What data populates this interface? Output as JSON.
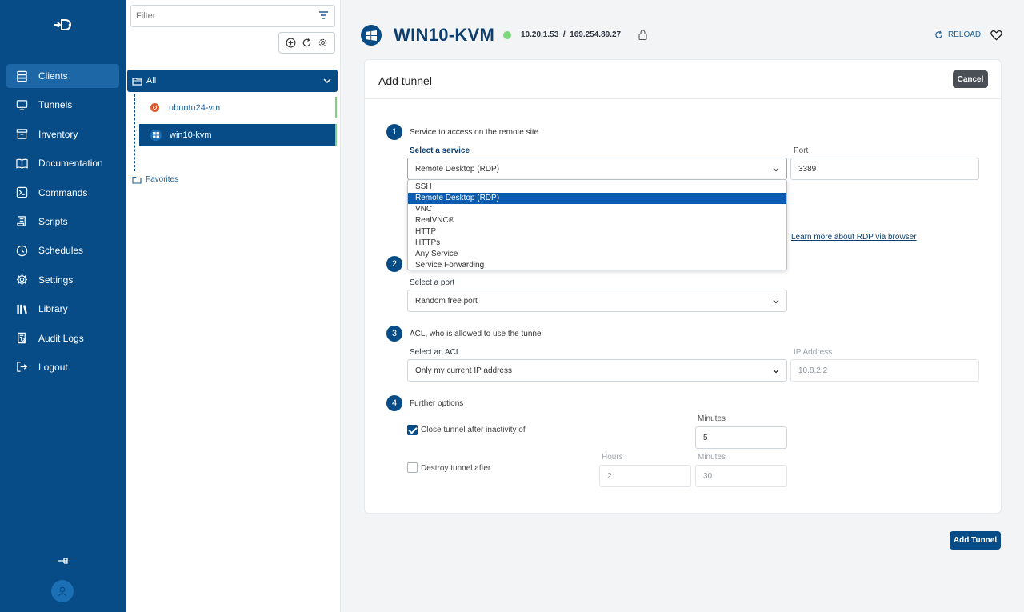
{
  "sidebar": {
    "items": [
      {
        "label": "Clients",
        "icon": "server-icon",
        "active": true
      },
      {
        "label": "Tunnels",
        "icon": "monitor-icon"
      },
      {
        "label": "Inventory",
        "icon": "archive-icon"
      },
      {
        "label": "Documentation",
        "icon": "book-icon"
      },
      {
        "label": "Commands",
        "icon": "terminal-icon"
      },
      {
        "label": "Scripts",
        "icon": "script-icon"
      },
      {
        "label": "Schedules",
        "icon": "clock-icon"
      },
      {
        "label": "Settings",
        "icon": "gear-icon"
      },
      {
        "label": "Library",
        "icon": "library-icon"
      },
      {
        "label": "Audit Logs",
        "icon": "audit-icon"
      },
      {
        "label": "Logout",
        "icon": "logout-icon"
      }
    ]
  },
  "tree": {
    "filter_placeholder": "Filter",
    "group_label": "All",
    "clients": [
      {
        "name": "ubuntu24-vm",
        "os": "ubuntu"
      },
      {
        "name": "win10-kvm",
        "os": "windows",
        "selected": true
      }
    ],
    "favorites_label": "Favorites"
  },
  "header": {
    "title": "WIN10-KVM",
    "ip": "10.20.1.53  /  169.254.89.27",
    "status_color": "#7dd87d",
    "reload_label": "RELOAD"
  },
  "form": {
    "title": "Add tunnel",
    "cancel_label": "Cancel",
    "step1": {
      "number": "1",
      "label": "Service to access on the remote site",
      "service_label": "Select a service",
      "service_value": "Remote Desktop (RDP)",
      "port_label": "Port",
      "port_value": "3389",
      "learn_more": "Learn more about RDP via browser"
    },
    "dropdown_options": [
      "SSH",
      "Remote Desktop (RDP)",
      "VNC",
      "RealVNC®",
      "HTTP",
      "HTTPs",
      "Any Service",
      "Service Forwarding"
    ],
    "dropdown_selected": "Remote Desktop (RDP)",
    "step2": {
      "number": "2",
      "port_label": "Select a port",
      "port_value": "Random free port"
    },
    "step3": {
      "number": "3",
      "label": "ACL, who is allowed to use the tunnel",
      "acl_label": "Select an ACL",
      "acl_value": "Only my current IP address",
      "ip_label": "IP Address",
      "ip_value": "10.8.2.2"
    },
    "step4": {
      "number": "4",
      "label": "Further options",
      "close_label": "Close tunnel after inactivity of",
      "close_checked": true,
      "minutes_label": "Minutes",
      "minutes_value": "5",
      "destroy_label": "Destroy tunnel after",
      "destroy_checked": false,
      "hours_label": "Hours",
      "hours_value": "2",
      "minutes2_label": "Minutes",
      "minutes2_value": "30"
    },
    "submit_label": "Add Tunnel"
  },
  "colors": {
    "brand": "#074c87",
    "accent": "#0b5cb0"
  }
}
